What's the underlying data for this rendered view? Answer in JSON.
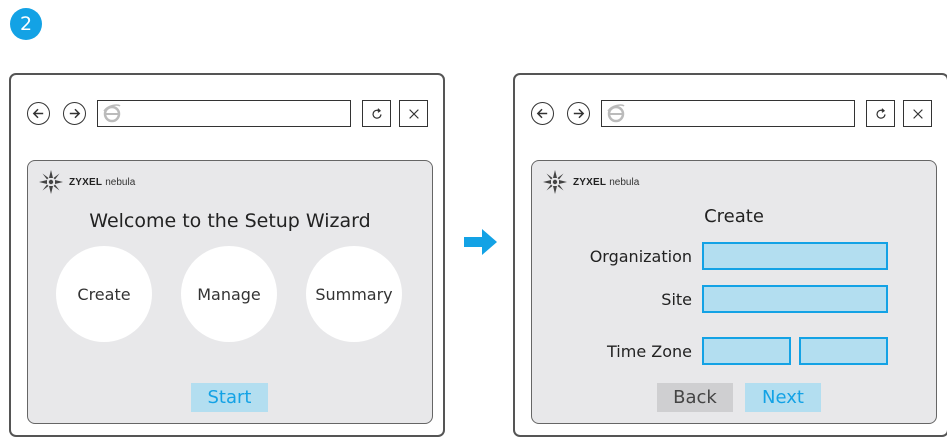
{
  "step": {
    "number": "2"
  },
  "browser": {
    "icons": [
      "back-arrow-icon",
      "forward-arrow-icon",
      "ie-browser-icon",
      "refresh-icon",
      "close-icon"
    ],
    "address_value": ""
  },
  "brand": {
    "name": "ZYXEL",
    "product": "nebula"
  },
  "welcome_screen": {
    "title": "Welcome to the Setup Wizard",
    "options": [
      "Create",
      "Manage",
      "Summary"
    ],
    "start_label": "Start"
  },
  "create_screen": {
    "title": "Create",
    "fields": [
      {
        "label": "Organization",
        "value": ""
      },
      {
        "label": "Site",
        "value": ""
      },
      {
        "label": "Time Zone",
        "value": ""
      }
    ],
    "back_label": "Back",
    "next_label": "Next"
  },
  "colors": {
    "accent": "#13a2e5",
    "input_fill": "#b3def0",
    "panel_bg": "#e8e8ea",
    "back_button": "#cfcfd1"
  }
}
